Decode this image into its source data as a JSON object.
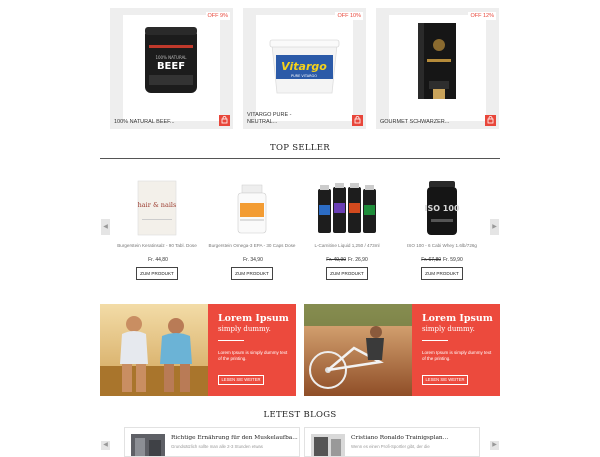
{
  "featured": [
    {
      "name": "100% NATURAL BEEF...",
      "badge": "OFF 9%"
    },
    {
      "name": "VITARGO PURE - NEUTRAL...",
      "badge": "OFF 10%",
      "brand": "Vitargo",
      "sub": "PURE VITARGO"
    },
    {
      "name": "GOURMET SCHWARZER...",
      "badge": "OFF 12%"
    }
  ],
  "beef_label": "BEEF",
  "beef_sub": "100% NATURAL",
  "brand_colors": {
    "accent": "#ec4a3d",
    "badge": "#e8463a"
  },
  "top_seller": {
    "title": "TOP SELLER",
    "products": [
      {
        "name": "Burgerstein Keratinsalz - 90 Tabl. Dose",
        "price": "Fr. 44,80",
        "old": "",
        "button": "ZUM PRODUKT",
        "label": "hair & nails"
      },
      {
        "name": "Burgerstein Omega-3 EPA - 30 Caps Dose",
        "price": "Fr. 34,90",
        "old": "",
        "button": "ZUM PRODUKT"
      },
      {
        "name": "L-Carnitine Liquid 1,250 / 473ml",
        "price": "Fr. 26,90",
        "old": "Fr. 49,90",
        "button": "ZUM PRODUKT"
      },
      {
        "name": "ISO 100 - 6 Cabi Whey 1.6lb/726g",
        "price": "Fr. 59,90",
        "old": "Fr. 67,80",
        "button": "ZUM PRODUKT",
        "label": "ISO 100"
      }
    ]
  },
  "banners": [
    {
      "heading": "Lorem Ipsum",
      "subheading": "simply dummy.",
      "text": "Lorem Ipsum is simply dummy text of the printing.",
      "button": "LESEN SIE WEITER"
    },
    {
      "heading": "Lorem Ipsum",
      "subheading": "simply dummy.",
      "text": "Lorem Ipsum is simply dummy text of the printing.",
      "button": "LESEN SIE WEITER"
    }
  ],
  "blogs": {
    "title": "LETEST BLOGS",
    "items": [
      {
        "title": "Richtige Ernährung für den Muskelaufba...",
        "snippet": "Grundsätzlich sollte man alle 2-3 Stunden etwas"
      },
      {
        "title": "Cristiano Ronaldo Trainigsplan...",
        "snippet": "Wenn es einen Profi-Sportler gibt, der die"
      }
    ]
  }
}
